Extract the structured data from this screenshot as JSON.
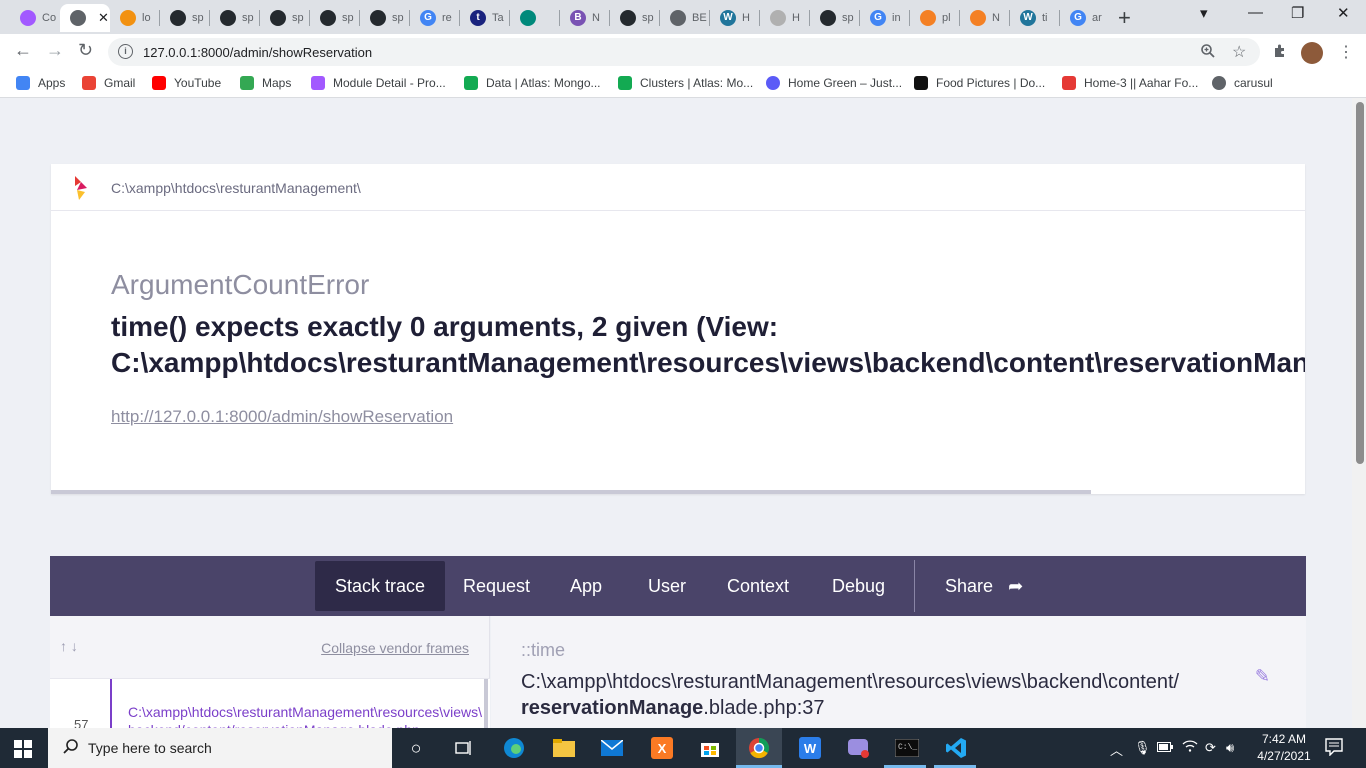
{
  "browser": {
    "tabs": [
      {
        "label": "Co",
        "icon": "figma-icon",
        "color": "#a259ff"
      },
      {
        "label": "",
        "icon": "globe-icon",
        "color": "#5f6368",
        "active": true
      },
      {
        "label": "lo",
        "icon": "phpmyadmin-icon",
        "color": "#f29111"
      },
      {
        "label": "sp",
        "icon": "github-icon",
        "color": "#24292e"
      },
      {
        "label": "sp",
        "icon": "github-icon",
        "color": "#24292e"
      },
      {
        "label": "sp",
        "icon": "github-icon",
        "color": "#24292e"
      },
      {
        "label": "sp",
        "icon": "github-icon",
        "color": "#24292e"
      },
      {
        "label": "sp",
        "icon": "github-icon",
        "color": "#24292e"
      },
      {
        "label": "re",
        "icon": "google-icon",
        "color": "#4285f4"
      },
      {
        "label": "Ta",
        "icon": "tin-icon",
        "color": "#1a237e"
      },
      {
        "label": "",
        "icon": "meet-icon",
        "color": "#00897b"
      },
      {
        "label": "N",
        "icon": "bootstrap-icon",
        "color": "#7952b3"
      },
      {
        "label": "sp",
        "icon": "github-icon",
        "color": "#24292e"
      },
      {
        "label": "BE",
        "icon": "globe-icon",
        "color": "#5f6368"
      },
      {
        "label": "H",
        "icon": "wordpress-icon",
        "color": "#21759b"
      },
      {
        "label": "H",
        "icon": "cloud-icon",
        "color": "#b0b0b0"
      },
      {
        "label": "sp",
        "icon": "github-icon",
        "color": "#24292e"
      },
      {
        "label": "in",
        "icon": "google-icon",
        "color": "#4285f4"
      },
      {
        "label": "pl",
        "icon": "stackoverflow-icon",
        "color": "#f48024"
      },
      {
        "label": "N",
        "icon": "stackoverflow-icon",
        "color": "#f48024"
      },
      {
        "label": "ti",
        "icon": "wordpress-icon",
        "color": "#21759b"
      },
      {
        "label": "ar",
        "icon": "google-icon",
        "color": "#4285f4"
      }
    ],
    "tab_close": "✕",
    "new_tab": "+",
    "window": {
      "minimize": "▾",
      "restore": "—",
      "maximize": "❐",
      "close": "✕"
    },
    "nav": {
      "back": "←",
      "forward": "→",
      "reload": "↻"
    },
    "url": "127.0.0.1:8000/admin/showReservation",
    "bookmarks": [
      {
        "label": "Apps",
        "icon": "apps-grid-icon",
        "color": "#4285f4"
      },
      {
        "label": "Gmail",
        "icon": "gmail-icon",
        "color": "#ea4335"
      },
      {
        "label": "YouTube",
        "icon": "youtube-icon",
        "color": "#ff0000"
      },
      {
        "label": "Maps",
        "icon": "maps-icon",
        "color": "#34a853"
      },
      {
        "label": "Module Detail - Pro...",
        "icon": "module-icon",
        "color": "#a259ff"
      },
      {
        "label": "Data | Atlas: Mongo...",
        "icon": "mongodb-leaf-icon",
        "color": "#13aa52"
      },
      {
        "label": "Clusters | Atlas: Mo...",
        "icon": "mongodb-leaf-icon",
        "color": "#13aa52"
      },
      {
        "label": "Home Green – Just...",
        "icon": "wix-icon",
        "color": "#5b5bf7"
      },
      {
        "label": "Food Pictures | Do...",
        "icon": "unsplash-icon",
        "color": "#111111"
      },
      {
        "label": "Home-3 || Aahar Fo...",
        "icon": "h-logo-icon",
        "color": "#e53935"
      },
      {
        "label": "carusul",
        "icon": "globe-icon",
        "color": "#5f6368"
      }
    ]
  },
  "error_page": {
    "app_path": "C:\\xampp\\htdocs\\resturantManagement\\",
    "exception_class": "ArgumentCountError",
    "exception_message_line1": "time() expects exactly 0 arguments, 2 given (View:",
    "exception_message_line2": "C:\\xampp\\htdocs\\resturantManagement\\resources\\views\\backend\\content\\reservationManage.blade.php)",
    "request_url": "http://127.0.0.1:8000/admin/showReservation",
    "tabs": {
      "stack_trace": "Stack trace",
      "request": "Request",
      "app": "App",
      "user": "User",
      "context": "Context",
      "debug": "Debug",
      "share": "Share"
    },
    "collapse_vendor": "Collapse vendor frames",
    "frame": {
      "number": "57",
      "path_line1": "C:\\xampp\\htdocs\\resturantManagement\\resources\\views\\",
      "path_line2": "backend/content/reservationManage.blade.php"
    },
    "selected_frame": {
      "function": "::time",
      "file_dir": "C:\\xampp\\htdocs\\resturantManagement\\resources\\views\\backend\\content/",
      "file_name": "reservationManage",
      "file_suffix": ".blade.php:37"
    },
    "accent_color": "#4a4469"
  },
  "taskbar": {
    "search_placeholder": "Type here to search",
    "time": "7:42 AM",
    "date": "4/27/2021"
  }
}
